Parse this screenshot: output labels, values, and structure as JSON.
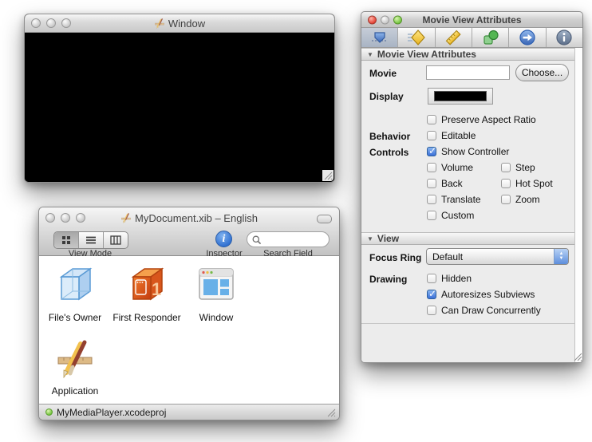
{
  "design_window": {
    "title": "Window"
  },
  "xib_window": {
    "title": "MyDocument.xib – English",
    "toolbar": {
      "view_mode_label": "View Mode",
      "inspector_label": "Inspector",
      "search_label": "Search Field",
      "search_value": ""
    },
    "items": [
      {
        "label": "File's Owner"
      },
      {
        "label": "First Responder"
      },
      {
        "label": "Window"
      },
      {
        "label": "Application"
      }
    ],
    "status_text": "MyMediaPlayer.xcodeproj"
  },
  "inspector": {
    "title": "Movie View Attributes",
    "toolbar_icons": [
      "attributes",
      "effects",
      "size",
      "bindings",
      "connections",
      "identity"
    ],
    "attributes_section": {
      "header": "Movie View Attributes",
      "movie_label": "Movie",
      "movie_value": "",
      "choose_label": "Choose...",
      "display_label": "Display",
      "behavior_label": "Behavior",
      "controls_label": "Controls",
      "checks": {
        "preserve": {
          "label": "Preserve Aspect Ratio",
          "checked": false
        },
        "editable": {
          "label": "Editable",
          "checked": false
        },
        "show_controller": {
          "label": "Show Controller",
          "checked": true
        },
        "volume": {
          "label": "Volume",
          "checked": false
        },
        "step": {
          "label": "Step",
          "checked": false
        },
        "back": {
          "label": "Back",
          "checked": false
        },
        "hot_spot": {
          "label": "Hot Spot",
          "checked": false
        },
        "translate": {
          "label": "Translate",
          "checked": false
        },
        "zoom": {
          "label": "Zoom",
          "checked": false
        },
        "custom": {
          "label": "Custom",
          "checked": false
        }
      }
    },
    "view_section": {
      "header": "View",
      "focus_ring_label": "Focus Ring",
      "focus_ring_value": "Default",
      "drawing_label": "Drawing",
      "checks": {
        "hidden": {
          "label": "Hidden",
          "checked": false
        },
        "autoresizes": {
          "label": "Autoresizes Subviews",
          "checked": true
        },
        "concurrent": {
          "label": "Can Draw Concurrently",
          "checked": false
        }
      }
    }
  },
  "colors": {
    "display_swatch": "#000000",
    "checked_blue": "#3a6fd8",
    "status_led": "#6cc036"
  }
}
